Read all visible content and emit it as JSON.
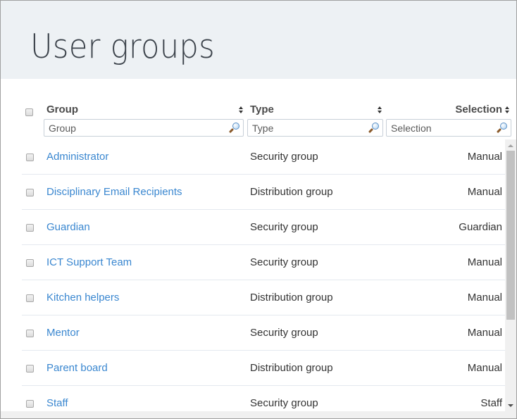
{
  "header": {
    "title": "User groups"
  },
  "table": {
    "columns": [
      {
        "label": "Group",
        "filter_placeholder": "Group"
      },
      {
        "label": "Type",
        "filter_placeholder": "Type"
      },
      {
        "label": "Selection",
        "filter_placeholder": "Selection"
      }
    ],
    "rows": [
      {
        "group": "Administrator",
        "type": "Security group",
        "selection": "Manual"
      },
      {
        "group": "Disciplinary Email Recipients",
        "type": "Distribution group",
        "selection": "Manual"
      },
      {
        "group": "Guardian",
        "type": "Security group",
        "selection": "Guardian"
      },
      {
        "group": "ICT Support Team",
        "type": "Security group",
        "selection": "Manual"
      },
      {
        "group": "Kitchen helpers",
        "type": "Distribution group",
        "selection": "Manual"
      },
      {
        "group": "Mentor",
        "type": "Security group",
        "selection": "Manual"
      },
      {
        "group": "Parent board",
        "type": "Distribution group",
        "selection": "Manual"
      },
      {
        "group": "Staff",
        "type": "Security group",
        "selection": "Staff"
      }
    ]
  },
  "colors": {
    "link": "#3a87d0",
    "header_bg": "#edf1f4",
    "title": "#3c434b"
  }
}
